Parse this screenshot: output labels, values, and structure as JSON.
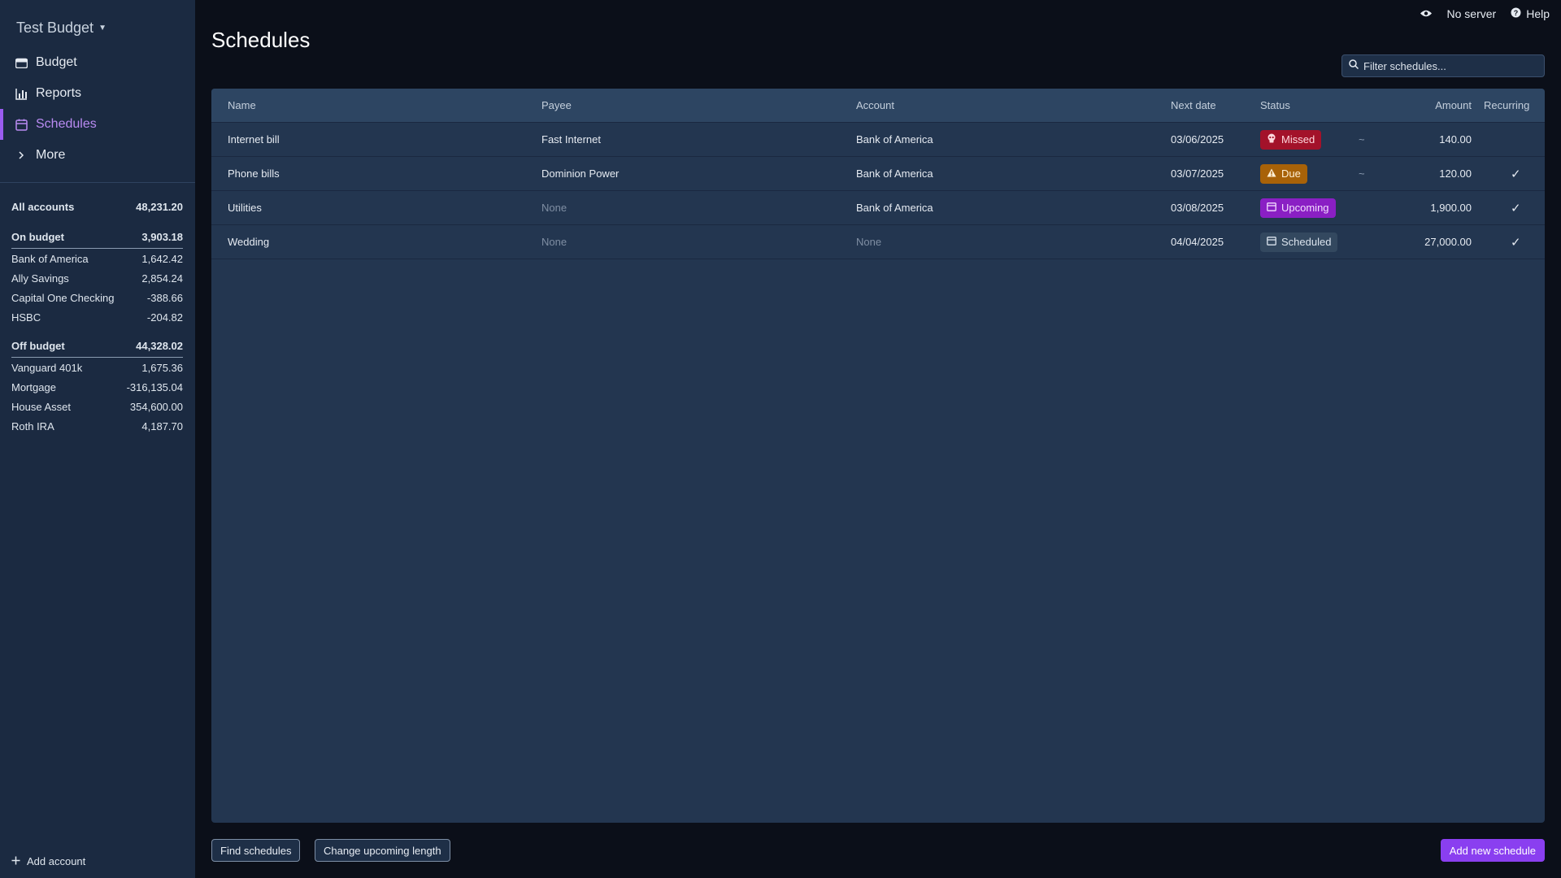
{
  "sidebar": {
    "budget_name": "Test Budget",
    "nav": [
      {
        "label": "Budget",
        "icon": "wallet-icon"
      },
      {
        "label": "Reports",
        "icon": "bar-chart-icon"
      },
      {
        "label": "Schedules",
        "icon": "calendar-icon",
        "active": true
      },
      {
        "label": "More",
        "icon": "chevron-right-icon"
      }
    ],
    "all_accounts": {
      "label": "All accounts",
      "amount": "48,231.20"
    },
    "on_budget": {
      "label": "On budget",
      "amount": "3,903.18"
    },
    "on_budget_accounts": [
      {
        "label": "Bank of America",
        "amount": "1,642.42"
      },
      {
        "label": "Ally Savings",
        "amount": "2,854.24"
      },
      {
        "label": "Capital One Checking",
        "amount": "-388.66"
      },
      {
        "label": "HSBC",
        "amount": "-204.82"
      }
    ],
    "off_budget": {
      "label": "Off budget",
      "amount": "44,328.02"
    },
    "off_budget_accounts": [
      {
        "label": "Vanguard 401k",
        "amount": "1,675.36"
      },
      {
        "label": "Mortgage",
        "amount": "-316,135.04"
      },
      {
        "label": "House Asset",
        "amount": "354,600.00"
      },
      {
        "label": "Roth IRA",
        "amount": "4,187.70"
      }
    ],
    "add_account": "Add account"
  },
  "topbar": {
    "server": "No server",
    "help": "Help"
  },
  "page": {
    "title": "Schedules",
    "filter_placeholder": "Filter schedules..."
  },
  "table": {
    "headers": {
      "name": "Name",
      "payee": "Payee",
      "account": "Account",
      "next_date": "Next date",
      "status": "Status",
      "amount": "Amount",
      "recurring": "Recurring"
    },
    "rows": [
      {
        "name": "Internet bill",
        "payee": "Fast Internet",
        "payee_muted": false,
        "account": "Bank of America",
        "account_muted": false,
        "next_date": "03/06/2025",
        "status": "Missed",
        "status_class": "missed",
        "status_icon": "skull-icon",
        "approx": "~",
        "amount": "140.00",
        "recurring": ""
      },
      {
        "name": "Phone bills",
        "payee": "Dominion Power",
        "payee_muted": false,
        "account": "Bank of America",
        "account_muted": false,
        "next_date": "03/07/2025",
        "status": "Due",
        "status_class": "due",
        "status_icon": "warning-icon",
        "approx": "~",
        "amount": "120.00",
        "recurring": "✓"
      },
      {
        "name": "Utilities",
        "payee": "None",
        "payee_muted": true,
        "account": "Bank of America",
        "account_muted": false,
        "next_date": "03/08/2025",
        "status": "Upcoming",
        "status_class": "upcoming",
        "status_icon": "calendar-icon",
        "approx": "",
        "amount": "1,900.00",
        "recurring": "✓"
      },
      {
        "name": "Wedding",
        "payee": "None",
        "payee_muted": true,
        "account": "None",
        "account_muted": true,
        "next_date": "04/04/2025",
        "status": "Scheduled",
        "status_class": "scheduled",
        "status_icon": "calendar-icon",
        "approx": "",
        "amount": "27,000.00",
        "recurring": "✓"
      }
    ],
    "menu_glyph": "···"
  },
  "footer": {
    "find_schedules": "Find schedules",
    "change_upcoming": "Change upcoming length",
    "add_new": "Add new schedule"
  }
}
